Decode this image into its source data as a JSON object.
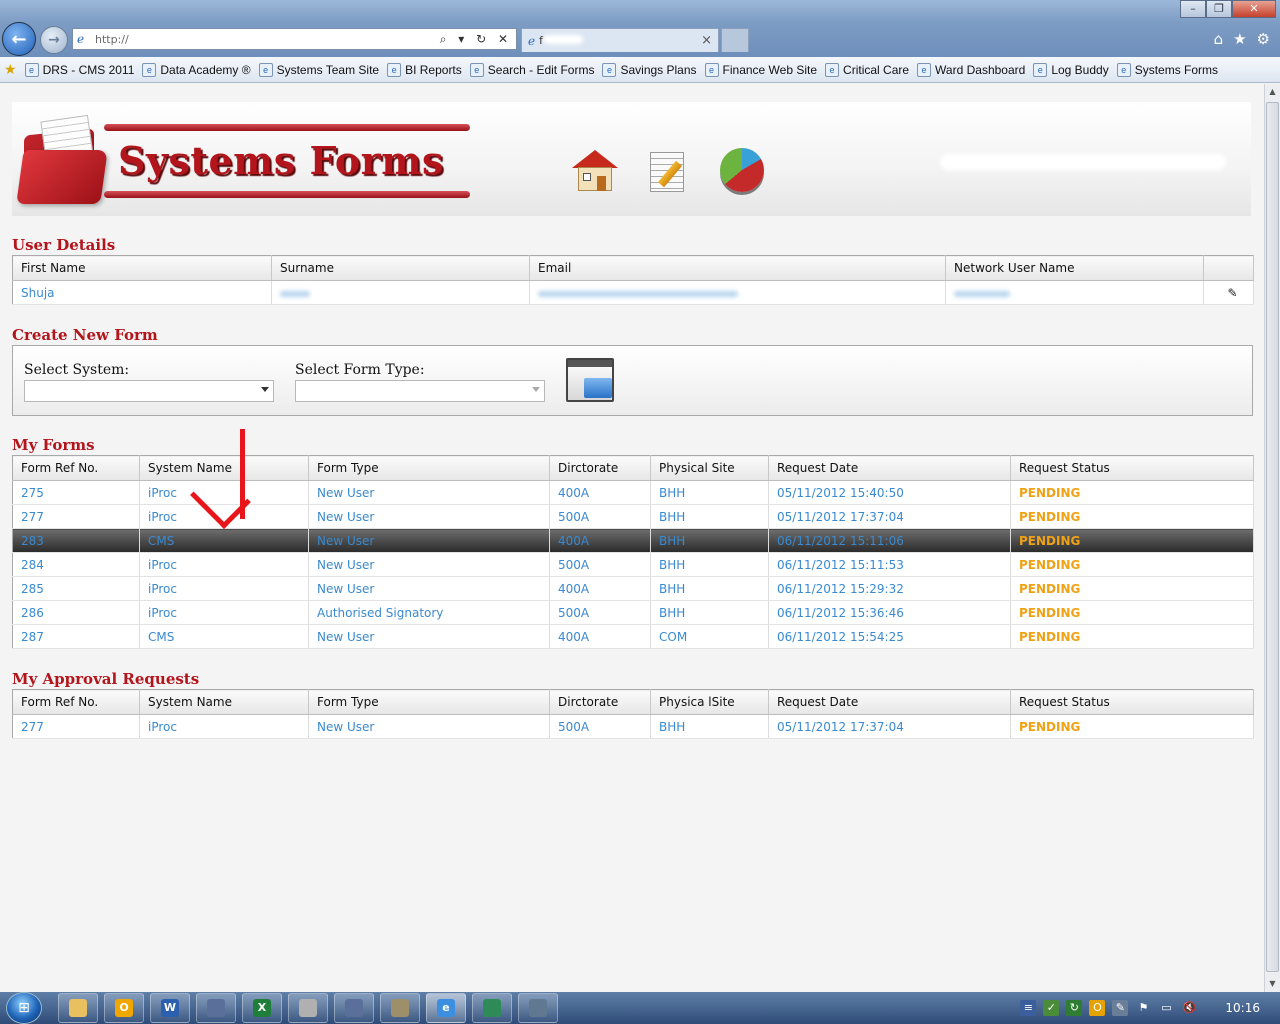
{
  "browser": {
    "url": "http://",
    "tab_title": "f",
    "tab_close": "×",
    "addr_icons": "⌕ ▾ ↻ ✕"
  },
  "favorites": [
    {
      "label": "DRS - CMS 2011"
    },
    {
      "label": "Data Academy ®"
    },
    {
      "label": "Systems Team Site"
    },
    {
      "label": "BI Reports"
    },
    {
      "label": "Search - Edit Forms"
    },
    {
      "label": "Savings Plans"
    },
    {
      "label": "Finance Web Site"
    },
    {
      "label": "Critical Care"
    },
    {
      "label": "Ward Dashboard"
    },
    {
      "label": "Log Buddy"
    },
    {
      "label": "Systems Forms"
    }
  ],
  "header": {
    "logo_text": "Systems Forms",
    "nav_icons": [
      "home-icon",
      "edit-document-icon",
      "pie-chart-icon"
    ]
  },
  "user_details": {
    "title": "User Details",
    "columns": [
      "First Name",
      "Surname",
      "Email",
      "Network User Name"
    ],
    "row": {
      "first_name": "Shuja",
      "surname": "",
      "email": "",
      "network_user_name": ""
    },
    "edit_icon": "pencil-icon"
  },
  "create_form": {
    "title": "Create New Form",
    "system_label": "Select System:",
    "system_value": "",
    "form_type_label": "Select Form Type:",
    "form_type_value": ""
  },
  "my_forms": {
    "title": "My Forms",
    "columns": [
      "Form Ref No.",
      "System Name",
      "Form Type",
      "Dirctorate",
      "Physical Site",
      "Request Date",
      "Request Status"
    ],
    "selected_ref": "283",
    "rows": [
      [
        "275",
        "iProc",
        "New User",
        "400A",
        "BHH",
        "05/11/2012 15:40:50",
        "PENDING"
      ],
      [
        "277",
        "iProc",
        "New User",
        "500A",
        "BHH",
        "05/11/2012 17:37:04",
        "PENDING"
      ],
      [
        "283",
        "CMS",
        "New User",
        "400A",
        "BHH",
        "06/11/2012 15:11:06",
        "PENDING"
      ],
      [
        "284",
        "iProc",
        "New User",
        "500A",
        "BHH",
        "06/11/2012 15:11:53",
        "PENDING"
      ],
      [
        "285",
        "iProc",
        "New User",
        "400A",
        "BHH",
        "06/11/2012 15:29:32",
        "PENDING"
      ],
      [
        "286",
        "iProc",
        "Authorised Signatory",
        "500A",
        "BHH",
        "06/11/2012 15:36:46",
        "PENDING"
      ],
      [
        "287",
        "CMS",
        "New User",
        "400A",
        "COM",
        "06/11/2012 15:54:25",
        "PENDING"
      ]
    ]
  },
  "approval_requests": {
    "title": "My Approval Requests",
    "columns": [
      "Form Ref No.",
      "System Name",
      "Form Type",
      "Dirctorate",
      "Physica lSite",
      "Request Date",
      "Request Status"
    ],
    "rows": [
      [
        "277",
        "iProc",
        "New User",
        "500A",
        "BHH",
        "05/11/2012 17:37:04",
        "PENDING"
      ]
    ]
  },
  "colors": {
    "title_red": "#b3151c",
    "link_blue": "#3a8ad0",
    "status_orange": "#f0a214",
    "selected_row": "#2a2a2a"
  },
  "taskbar": {
    "apps": [
      {
        "icon": "explorer-icon",
        "label": ""
      },
      {
        "icon": "outlook-icon",
        "label": "O"
      },
      {
        "icon": "word-icon",
        "label": "W"
      },
      {
        "icon": "remote-desktop-icon",
        "label": ""
      },
      {
        "icon": "excel-icon",
        "label": "X"
      },
      {
        "icon": "paint-icon",
        "label": ""
      },
      {
        "icon": "remote-desktop-icon",
        "label": ""
      },
      {
        "icon": "tools-icon",
        "label": ""
      },
      {
        "icon": "internet-explorer-icon",
        "label": "e"
      },
      {
        "icon": "visual-studio-icon",
        "label": ""
      },
      {
        "icon": "notepad-icon",
        "label": ""
      }
    ],
    "clock": "10:16"
  }
}
